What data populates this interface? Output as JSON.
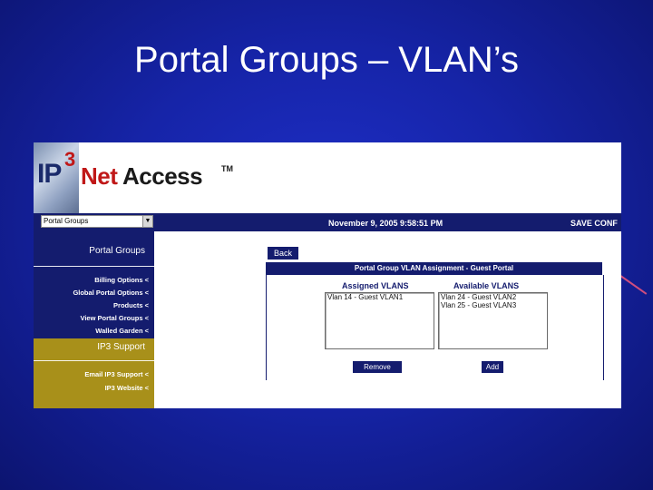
{
  "slide": {
    "title": "Portal Groups – VLAN’s"
  },
  "logo": {
    "ip": "IP",
    "three": "3",
    "net": "Net",
    "access": "Access",
    "tm": "TM"
  },
  "nav": {
    "select_value": "Portal Groups",
    "datetime": "November 9, 2005 9:58:51 PM",
    "save": "SAVE CONF"
  },
  "sidebar": {
    "heading": "Portal Groups",
    "items": [
      "Billing Options <",
      "Global Portal Options <",
      "Products <",
      "View Portal Groups <",
      "Walled Garden <"
    ],
    "support_heading": "IP3 Support",
    "support_items": [
      "Email IP3 Support <",
      "IP3 Website <"
    ]
  },
  "main": {
    "back_label": "Back",
    "panel_title": "Portal Group VLAN Assignment - Guest Portal",
    "assigned": {
      "header": "Assigned VLANS",
      "items": [
        "Vlan 14 - Guest VLAN1"
      ]
    },
    "available": {
      "header": "Available VLANS",
      "items": [
        "Vlan 24 - Guest VLAN2",
        "Vlan 25 - Guest VLAN3"
      ]
    },
    "remove_label": "Remove",
    "add_label": "Add"
  },
  "colors": {
    "navy": "#141c6e",
    "gold": "#a8901a",
    "slide_bg": "#1624a8"
  }
}
